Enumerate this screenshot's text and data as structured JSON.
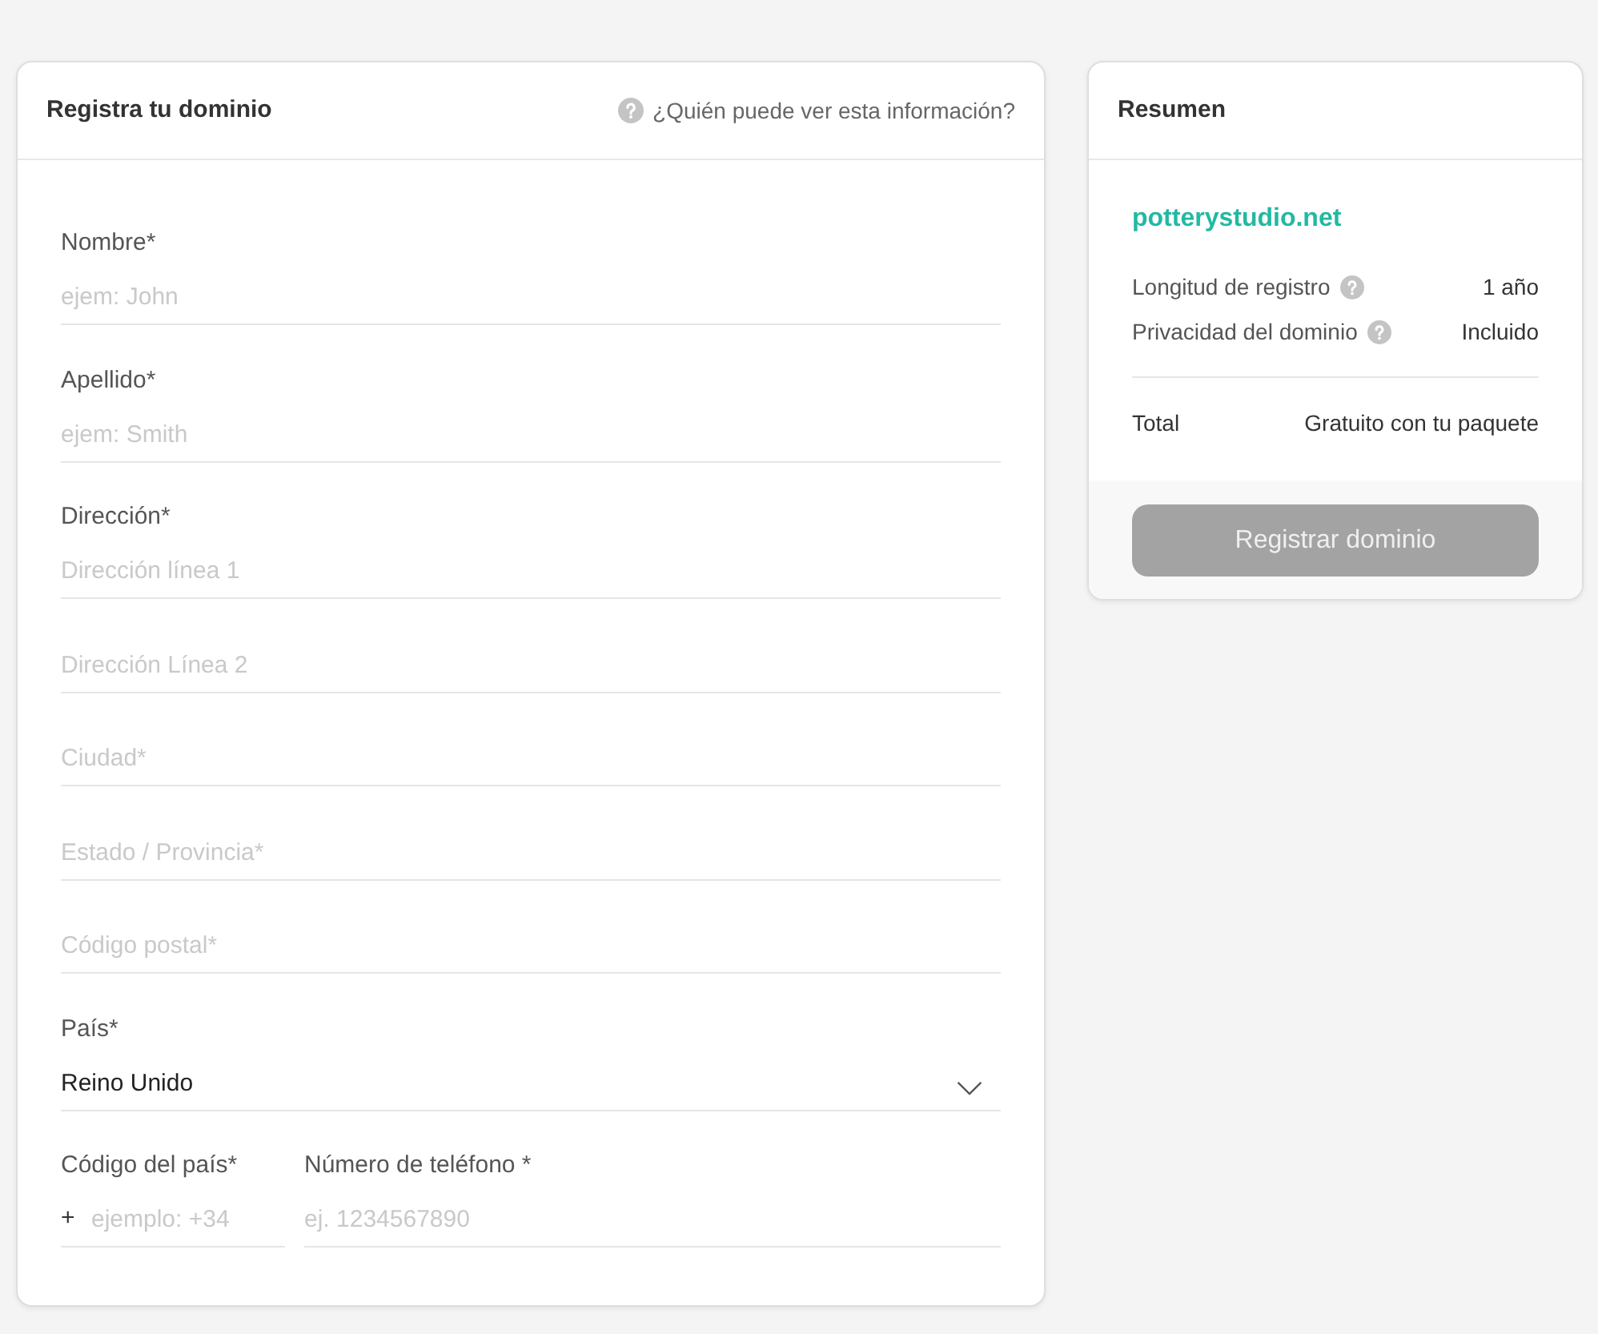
{
  "form": {
    "title": "Registra tu dominio",
    "help_link": "¿Quién puede ver esta información?",
    "fields": [
      {
        "kind": "text",
        "label": "Nombre*",
        "placeholder": "ejem: John"
      },
      {
        "kind": "text",
        "label": "Apellido*",
        "placeholder": "ejem: Smith"
      },
      {
        "kind": "text",
        "label": "Dirección*",
        "placeholder": "Dirección línea 1"
      },
      {
        "kind": "text",
        "placeholder": "Dirección Línea 2"
      },
      {
        "kind": "text",
        "placeholder": "Ciudad*"
      },
      {
        "kind": "text",
        "placeholder": "Estado / Provincia*"
      },
      {
        "kind": "text",
        "placeholder": "Código postal*"
      },
      {
        "kind": "select",
        "label": "País*",
        "value": "Reino Unido"
      }
    ],
    "phone": {
      "code": {
        "label": "Código del país*",
        "prefix": "+",
        "placeholder": "ejemplo: +34"
      },
      "number": {
        "label": "Número de teléfono *",
        "placeholder": "ej. 1234567890"
      }
    }
  },
  "summary": {
    "title": "Resumen",
    "domain": "potterystudio.net",
    "rows": [
      {
        "label": "Longitud de registro",
        "help": true,
        "value": "1 año"
      },
      {
        "label": "Privacidad del dominio",
        "help": true,
        "value": "Incluido"
      }
    ],
    "total": {
      "label": "Total",
      "value": "Gratuito con tu paquete"
    },
    "button": {
      "label": "Registrar dominio",
      "disabled": true
    }
  }
}
